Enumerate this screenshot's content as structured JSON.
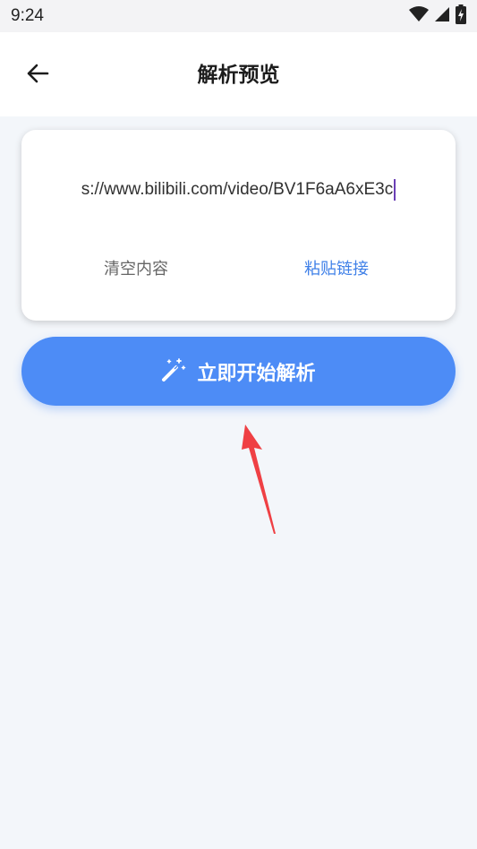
{
  "status_bar": {
    "time": "9:24",
    "icons": [
      "wifi-icon",
      "signal-icon",
      "battery-icon"
    ]
  },
  "header": {
    "title": "解析预览",
    "back_icon": "arrow-left-icon"
  },
  "input_card": {
    "url_value": "s://www.bilibili.com/video/BV1F6aA6xE3c",
    "clear_label": "清空内容",
    "paste_label": "粘贴链接"
  },
  "parse_button": {
    "label": "立即开始解析",
    "icon": "magic-wand-icon"
  },
  "colors": {
    "accent": "#4d8cf6",
    "link": "#3f80e8",
    "background": "#f3f6fa",
    "annotation_arrow": "#ef4044"
  }
}
